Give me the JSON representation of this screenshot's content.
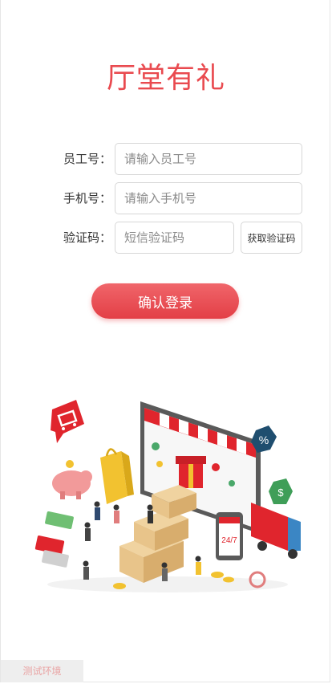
{
  "title": "厅堂有礼",
  "form": {
    "employee": {
      "label": "员工号：",
      "placeholder": "请输入员工号",
      "value": ""
    },
    "phone": {
      "label": "手机号：",
      "placeholder": "请输入手机号",
      "value": ""
    },
    "code": {
      "label": "验证码：",
      "placeholder": "短信验证码",
      "value": ""
    },
    "get_code_label": "获取验证码"
  },
  "login_label": "确认登录",
  "env_tag": "测试环境",
  "illustration": {
    "sign_text": "24/7",
    "badge_text": "%",
    "dollar_text": "$",
    "colors": {
      "accent": "#e94a4f",
      "store_red": "#e0252d",
      "box": "#e8c48a",
      "truck_blue": "#3b86c4"
    }
  },
  "colors": {
    "brand": "#e94a4f",
    "env_text": "#e9a3a3"
  }
}
